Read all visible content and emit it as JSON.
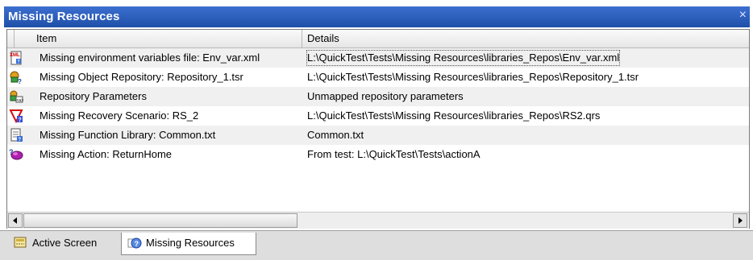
{
  "panel": {
    "title": "Missing Resources",
    "close_glyph": "×"
  },
  "columns": {
    "item": "Item",
    "details": "Details"
  },
  "rows": [
    {
      "icon": "xml-file-icon",
      "item": "Missing environment variables file: Env_var.xml",
      "details": "L:\\QuickTest\\Tests\\Missing Resources\\libraries_Repos\\Env_var.xml"
    },
    {
      "icon": "object-repository-icon",
      "item": "Missing Object Repository: Repository_1.tsr",
      "details": "L:\\QuickTest\\Tests\\Missing Resources\\libraries_Repos\\Repository_1.tsr"
    },
    {
      "icon": "repository-parameters-icon",
      "item": "Repository Parameters",
      "details": "Unmapped repository parameters"
    },
    {
      "icon": "recovery-scenario-icon",
      "item": "Missing Recovery Scenario: RS_2",
      "details": "L:\\QuickTest\\Tests\\Missing Resources\\libraries_Repos\\RS2.qrs"
    },
    {
      "icon": "function-library-icon",
      "item": "Missing Function Library: Common.txt",
      "details": "Common.txt"
    },
    {
      "icon": "action-icon",
      "item": "Missing Action: ReturnHome",
      "details": "From test: L:\\QuickTest\\Tests\\actionA"
    }
  ],
  "tabs": [
    {
      "label": "Active Screen",
      "icon": "active-screen-icon",
      "selected": false
    },
    {
      "label": "Missing Resources",
      "icon": "missing-resources-icon",
      "selected": true
    }
  ]
}
